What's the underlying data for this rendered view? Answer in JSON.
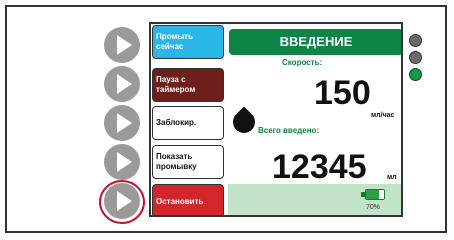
{
  "side_buttons": [
    "play-right",
    "play-right",
    "play-right",
    "play-right",
    "play-right"
  ],
  "menu": {
    "flush_now": "Промыть сейчас",
    "pause_timer": "Пауза с таймером",
    "lock": "Заблокир.",
    "show_flush": "Показать промывку",
    "stop": "Остановить"
  },
  "screen": {
    "title": "ВВЕДЕНИЕ",
    "rate_label": "Скорость:",
    "rate_value": "150",
    "rate_unit": "мл/час",
    "total_label": "Всего введено:",
    "total_value": "12345",
    "total_unit": "мл",
    "battery_percent": "70%",
    "battery_level": 0.7
  },
  "indicators": [
    {
      "name": "status-light-1",
      "color": "#6a6a6a"
    },
    {
      "name": "status-light-2",
      "color": "#6a6a6a"
    },
    {
      "name": "status-light-3",
      "color": "#0f9b48"
    }
  ],
  "colors": {
    "accent_green": "#0d8445",
    "flush_blue": "#2ab7e8",
    "pause_brown": "#6e1f1c",
    "stop_red": "#d3262b",
    "highlight_red": "#c8102e"
  }
}
